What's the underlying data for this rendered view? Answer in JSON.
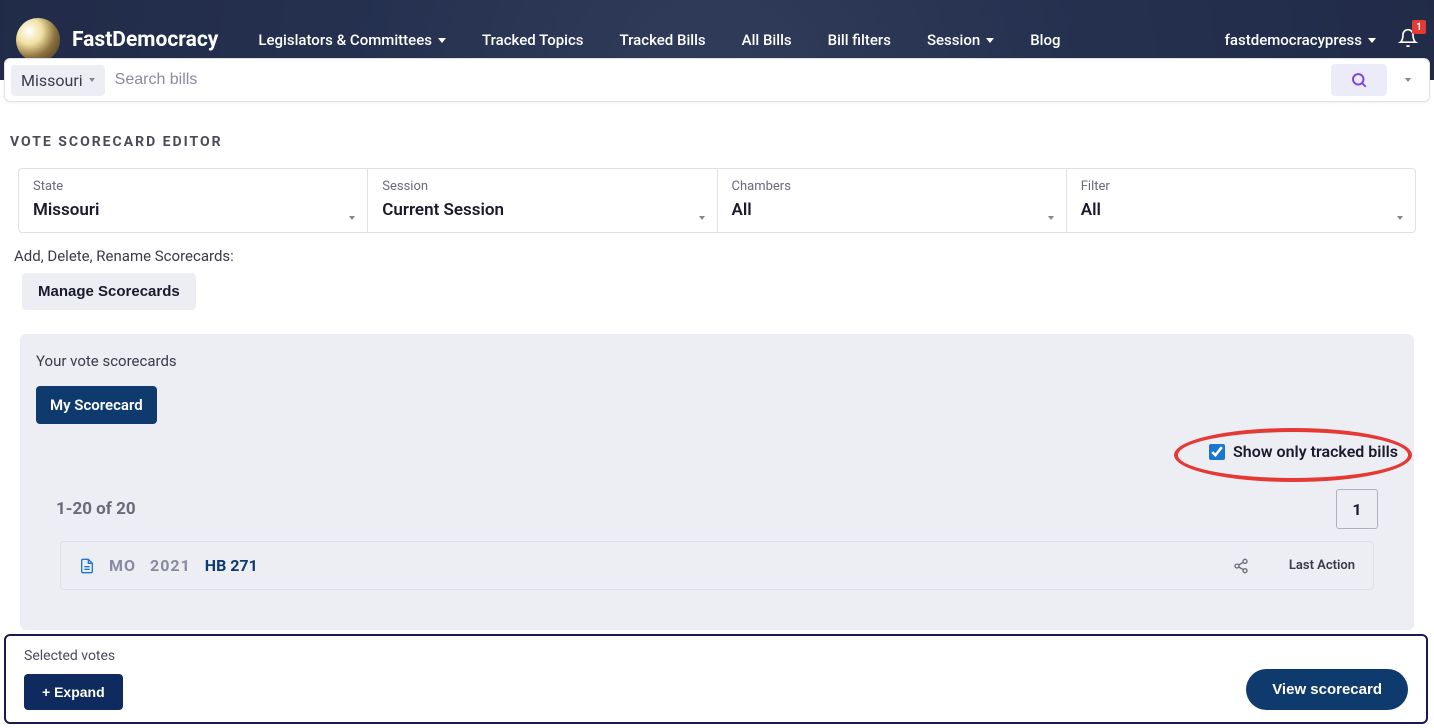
{
  "header": {
    "brand": "FastDemocracy",
    "nav": [
      "Legislators & Committees",
      "Tracked Topics",
      "Tracked Bills",
      "All Bills",
      "Bill filters",
      "Session",
      "Blog"
    ],
    "user": "fastdemocracypress",
    "notif_count": "1"
  },
  "search": {
    "state": "Missouri",
    "placeholder": "Search bills"
  },
  "page_title": "VOTE SCORECARD EDITOR",
  "filters": {
    "labels": {
      "state": "State",
      "session": "Session",
      "chambers": "Chambers",
      "filter": "Filter"
    },
    "values": {
      "state": "Missouri",
      "session": "Current Session",
      "chambers": "All",
      "filter": "All"
    }
  },
  "manage": {
    "line": "Add, Delete, Rename Scorecards:",
    "button": "Manage Scorecards"
  },
  "panel": {
    "label": "Your vote scorecards",
    "chip": "My Scorecard",
    "show_tracked": "Show only tracked bills"
  },
  "results": {
    "count": "1-20 of 20",
    "page": "1"
  },
  "bill": {
    "state": "MO",
    "year": "2021",
    "number": "HB 271",
    "last_action_label": "Last Action"
  },
  "footer": {
    "label": "Selected votes",
    "expand": "+ Expand",
    "view": "View scorecard"
  }
}
